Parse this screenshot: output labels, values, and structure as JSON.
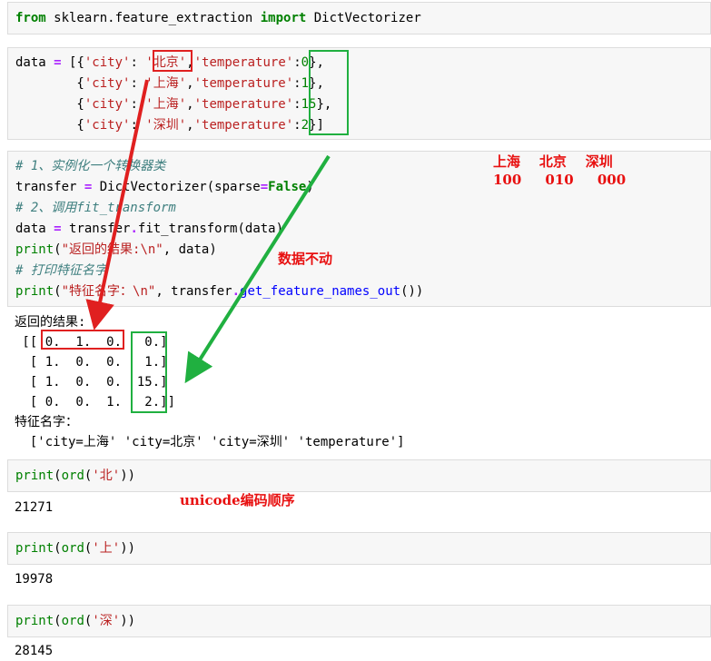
{
  "cell1": {
    "kw_from": "from",
    "module": " sklearn.feature_extraction ",
    "kw_import": "import",
    "name": " DictVectorizer"
  },
  "cell2": {
    "var": "data",
    "eq": " = ",
    "lines": [
      {
        "prefix": "[{",
        "k1": "'city'",
        "colon1": ": ",
        "v1": "'北京'",
        "comma": ",",
        "k2": "'temperature'",
        "colon2": ":",
        "v2": "0",
        "suffix": "},"
      },
      {
        "prefix": "        {",
        "k1": "'city'",
        "colon1": ": ",
        "v1": "'上海'",
        "comma": ",",
        "k2": "'temperature'",
        "colon2": ":",
        "v2": "1",
        "suffix": "},"
      },
      {
        "prefix": "        {",
        "k1": "'city'",
        "colon1": ": ",
        "v1": "'上海'",
        "comma": ",",
        "k2": "'temperature'",
        "colon2": ":",
        "v2": "15",
        "suffix": "},"
      },
      {
        "prefix": "        {",
        "k1": "'city'",
        "colon1": ": ",
        "v1": "'深圳'",
        "comma": ",",
        "k2": "'temperature'",
        "colon2": ":",
        "v2": "2",
        "suffix": "}]"
      }
    ]
  },
  "cell3": {
    "comment1": "# 1、实例化一个转换器类",
    "l2_a": "transfer ",
    "l2_eq": "=",
    "l2_b": " DictVectorizer(sparse",
    "l2_eq2": "=",
    "l2_false": "False",
    "l2_c": ")",
    "comment2": "# 2、调用fit_transform",
    "l4_a": "data ",
    "l4_eq": "=",
    "l4_b": " transfer",
    "l4_dot": ".",
    "l4_c": "fit_transform(data)",
    "l5_print": "print",
    "l5_a": "(",
    "l5_str": "\"返回的结果:\\n\"",
    "l5_b": ", data)",
    "comment3": "# 打印特征名字",
    "l7_print": "print",
    "l7_a": "(",
    "l7_str": "\"特征名字：\\n\"",
    "l7_b": ", transfer",
    "l7_dot": ".",
    "l7_c": "get_feature_names_out",
    "l7_d": "())"
  },
  "output3": {
    "title": "返回的结果:",
    "rows": [
      " [[ 0.  1.  0.   0.]",
      "  [ 1.  0.  0.   1.]",
      "  [ 1.  0.  0.  15.]",
      "  [ 0.  0.  1.   2.]]"
    ],
    "feature_title": "特征名字：",
    "features": "  ['city=上海' 'city=北京' 'city=深圳' 'temperature']"
  },
  "annotations": {
    "cities": "上海    北京    深圳",
    "codes": "100     010     000",
    "unchanged": "数据不动",
    "unicode": "unicode编码顺序"
  },
  "cell4": {
    "print": "print",
    "a": "(",
    "fn": "ord",
    "b": "(",
    "str": "'北'",
    "c": "))",
    "output": "21271"
  },
  "cell5": {
    "print": "print",
    "a": "(",
    "fn": "ord",
    "b": "(",
    "str": "'上'",
    "c": "))",
    "output": "19978"
  },
  "cell6": {
    "print": "print",
    "a": "(",
    "fn": "ord",
    "b": "(",
    "str": "'深'",
    "c": "))",
    "output": "28145"
  },
  "colors": {
    "red_annotation": "#e81010",
    "green_box": "#20b040",
    "red_box": "#e02020",
    "cell_bg": "#f7f7f7"
  }
}
